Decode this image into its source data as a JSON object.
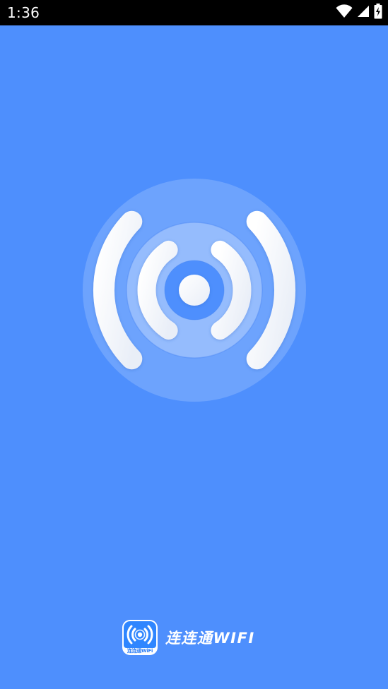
{
  "status_bar": {
    "time": "1:36",
    "icons": [
      "wifi-icon",
      "cellular-signal-icon",
      "battery-charging-icon"
    ]
  },
  "splash": {
    "background_color": "#4e8ffd",
    "hero_icon": "wifi-signal-icon"
  },
  "brand": {
    "app_icon_caption": "连连通WiFi",
    "app_name": "连连通WIFI"
  }
}
